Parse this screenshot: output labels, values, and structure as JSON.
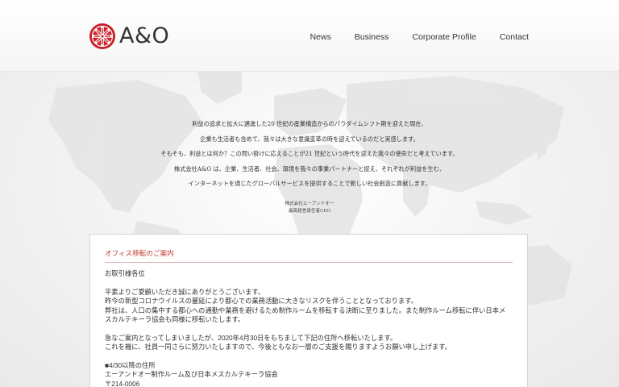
{
  "brand": {
    "name": "A&O",
    "accent": "#c8202a"
  },
  "nav": {
    "items": [
      {
        "label": "News"
      },
      {
        "label": "Business"
      },
      {
        "label": "Corporate Profile"
      },
      {
        "label": "Contact"
      }
    ]
  },
  "message": {
    "lines": [
      "利益の追求と拡大に邁進した20 世紀の産業構造からのパラダイムシフト期を迎えた現在、",
      "企業も生活者も含めて、我々は大きな意識変革の時を迎えているのだと実感します。",
      "そもそも、利益とは何か？この問い掛けに応えることが21 世紀という時代を迎えた我々の使命だと考えています。",
      "株式会社A&O は、企業、生活者、社会、環境を我々の事業パートナーと捉え、それぞれが利益を生む、",
      "インターネットを通じたグローバルサービスを提供することで新しい社会創造に貢献します。"
    ],
    "signature_company": "株式会社エーアンドオー",
    "signature_title": "最高経営責任者CEO"
  },
  "notice": {
    "title": "オフィス移転のご案内",
    "salutation": "お取引様各位",
    "para1": [
      "平素よりご愛顧いただき誠にありがとうございます。",
      "昨今の新型コロナウイルスの蔓延により都心での業務活動に大きなリスクを伴うこととなっております。",
      "弊社は、人口の集中する都心への通勤や業務を避けるため制作ルームを移転する決断に至りました。また制作ルーム移転に伴い日本メ",
      "スカルテキーラ協会も同様に移転いたします。"
    ],
    "para2": [
      "急なご案内となってしまいましたが、2020年4月30日をもちまして下記の住所へ移転いたします。",
      "これを機に、社員一同さらに努力いたしますので、今後ともなお一層のご支援を賜りますようお願い申し上げます。"
    ],
    "address": [
      "■4/30以降の住所",
      "エーアンドオー制作ルーム及び日本メスカルテキーラ協会",
      "〒214-0006"
    ]
  }
}
